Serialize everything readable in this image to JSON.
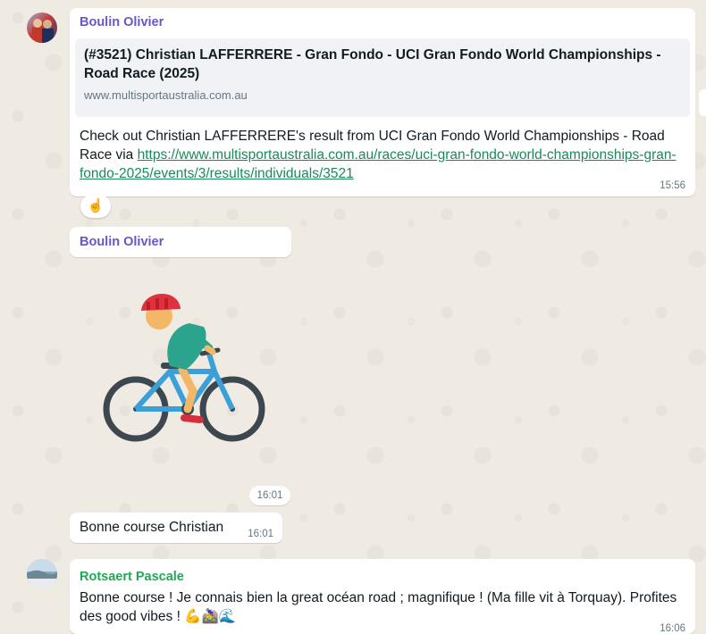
{
  "messages": [
    {
      "sender": "Boulin Olivier",
      "link_preview": {
        "title": "(#3521) Christian LAFFERRERE - Gran Fondo - UCI Gran Fondo World Championships - Road Race (2025)",
        "domain": "www.multisportaustralia.com.au"
      },
      "text_prefix": "Check out Christian LAFFERRERE's result from UCI Gran Fondo World Championships - Road Race via ",
      "link_url": "https://www.multisportaustralia.com.au/races/uci-gran-fondo-world-championships-gran-fondo-2025/events/3/results/individuals/3521",
      "time": "15:56",
      "reaction": "☝️"
    },
    {
      "sender": "Boulin Olivier",
      "sticker": "cyclist-sticker",
      "time": "16:01"
    },
    {
      "text": "Bonne course Christian",
      "time": "16:01"
    },
    {
      "sender": "Rotsaert Pascale",
      "text": "Bonne course ! Je connais bien la great océan road ; magnifique ! (Ma fille vit à Torquay). Profites des good vibes ! 💪🚵‍♀️🌊",
      "time": "16:06"
    }
  ],
  "colors": {
    "background": "#efeae2",
    "bubble": "#ffffff",
    "sender_purple": "#6b55c9",
    "sender_green": "#1fa855",
    "link": "#1a8a5a"
  }
}
